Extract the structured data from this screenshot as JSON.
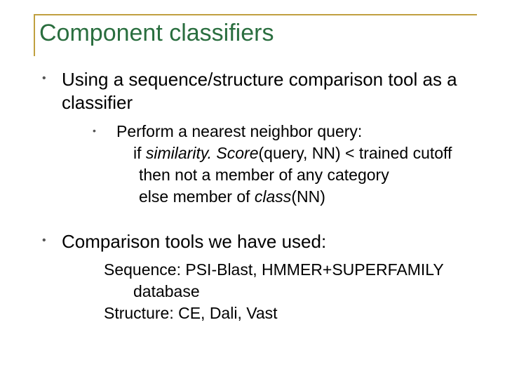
{
  "title": "Component classifiers",
  "b1": {
    "text": "Using a sequence/structure comparison tool as a classifier",
    "sub": {
      "l1": "Perform a nearest neighbor query:",
      "l2a": "if ",
      "l2b": "similarity. Score",
      "l2c": "(query, NN) < trained cutoff",
      "l3": "then not a member of any category",
      "l4a": "else member of ",
      "l4b": "class",
      "l4c": "(NN)"
    }
  },
  "b2": {
    "text": "Comparison tools we have used:",
    "seq1": "Sequence: PSI-Blast, HMMER+SUPERFAMILY",
    "seq2": "database",
    "struct": "Structure: CE, Dali, Vast"
  }
}
